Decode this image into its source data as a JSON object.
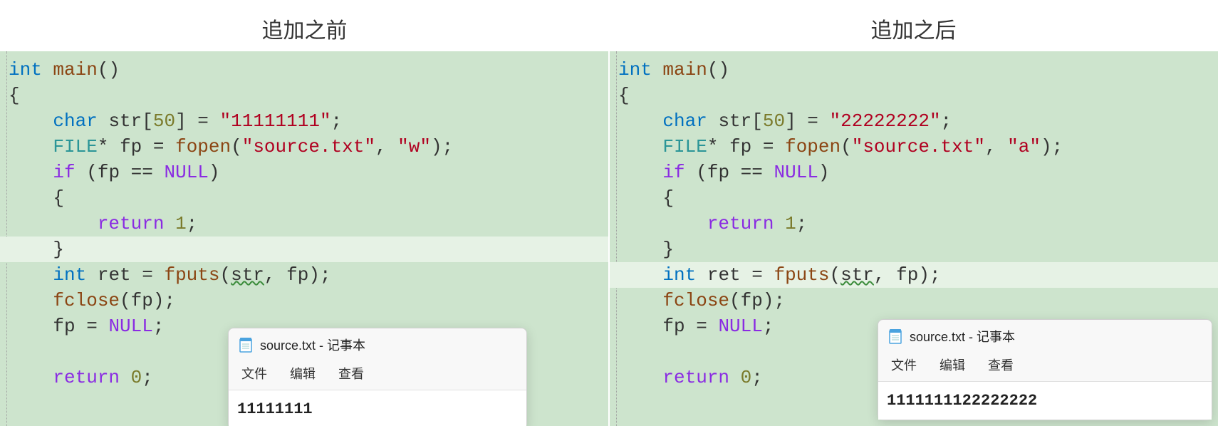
{
  "headers": {
    "left": "追加之前",
    "right": "追加之后"
  },
  "code": {
    "left": {
      "kw_int": "int",
      "fn_main": "main",
      "parens": "()",
      "brace_open": "{",
      "kw_char": "char",
      "var_str": "str",
      "arr_size": "50",
      "str_literal": "\"11111111\"",
      "type_file": "FILE",
      "star": "*",
      "var_fp": "fp",
      "fn_fopen": "fopen",
      "fname": "\"source.txt\"",
      "mode": "\"w\"",
      "kw_if": "if",
      "null": "NULL",
      "kw_return": "return",
      "one": "1",
      "brace_close": "}",
      "var_ret": "ret",
      "fn_fputs": "fputs",
      "fn_fclose": "fclose",
      "null2": "NULL",
      "zero": "0"
    },
    "right": {
      "kw_int": "int",
      "fn_main": "main",
      "parens": "()",
      "brace_open": "{",
      "kw_char": "char",
      "var_str": "str",
      "arr_size": "50",
      "str_literal": "\"22222222\"",
      "type_file": "FILE",
      "star": "*",
      "var_fp": "fp",
      "fn_fopen": "fopen",
      "fname": "\"source.txt\"",
      "mode": "\"a\"",
      "kw_if": "if",
      "null": "NULL",
      "kw_return": "return",
      "one": "1",
      "brace_close": "}",
      "var_ret": "ret",
      "fn_fputs": "fputs",
      "fn_fclose": "fclose",
      "null2": "NULL",
      "zero": "0"
    }
  },
  "notepad": {
    "left": {
      "title": "source.txt - 记事本",
      "menu": {
        "file": "文件",
        "edit": "编辑",
        "view": "查看"
      },
      "content": "11111111"
    },
    "right": {
      "title": "source.txt - 记事本",
      "menu": {
        "file": "文件",
        "edit": "编辑",
        "view": "查看"
      },
      "content": "1111111122222222"
    }
  }
}
